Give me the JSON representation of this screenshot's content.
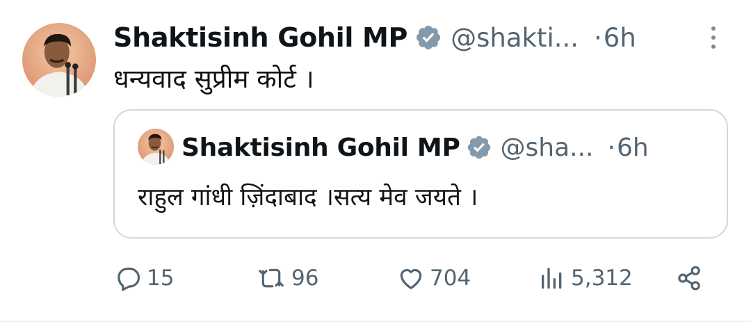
{
  "tweet": {
    "author_name": "Shaktisinh Gohil MP",
    "handle": "@shakti...",
    "separator": "·",
    "time": "6h",
    "text": "धन्यवाद सुप्रीम कोर्ट ।",
    "verified_icon": "verified-badge-icon",
    "more_icon": "more-options-icon"
  },
  "quote": {
    "author_name": "Shaktisinh Gohil MP",
    "handle": "@sha...",
    "separator": "·",
    "time": "6h",
    "text": "राहुल गांधी ज़िंदाबाद ।सत्य मेव जयते ।"
  },
  "actions": {
    "replies": {
      "icon": "reply-icon",
      "count": "15"
    },
    "retweets": {
      "icon": "retweet-icon",
      "count": "96"
    },
    "likes": {
      "icon": "like-icon",
      "count": "704"
    },
    "views": {
      "icon": "views-icon",
      "count": "5,312"
    },
    "share": {
      "icon": "share-icon"
    }
  },
  "colors": {
    "text_primary": "#0f1419",
    "text_secondary": "#536471",
    "border": "#cfd9de",
    "verified_badge": "#829aab"
  }
}
